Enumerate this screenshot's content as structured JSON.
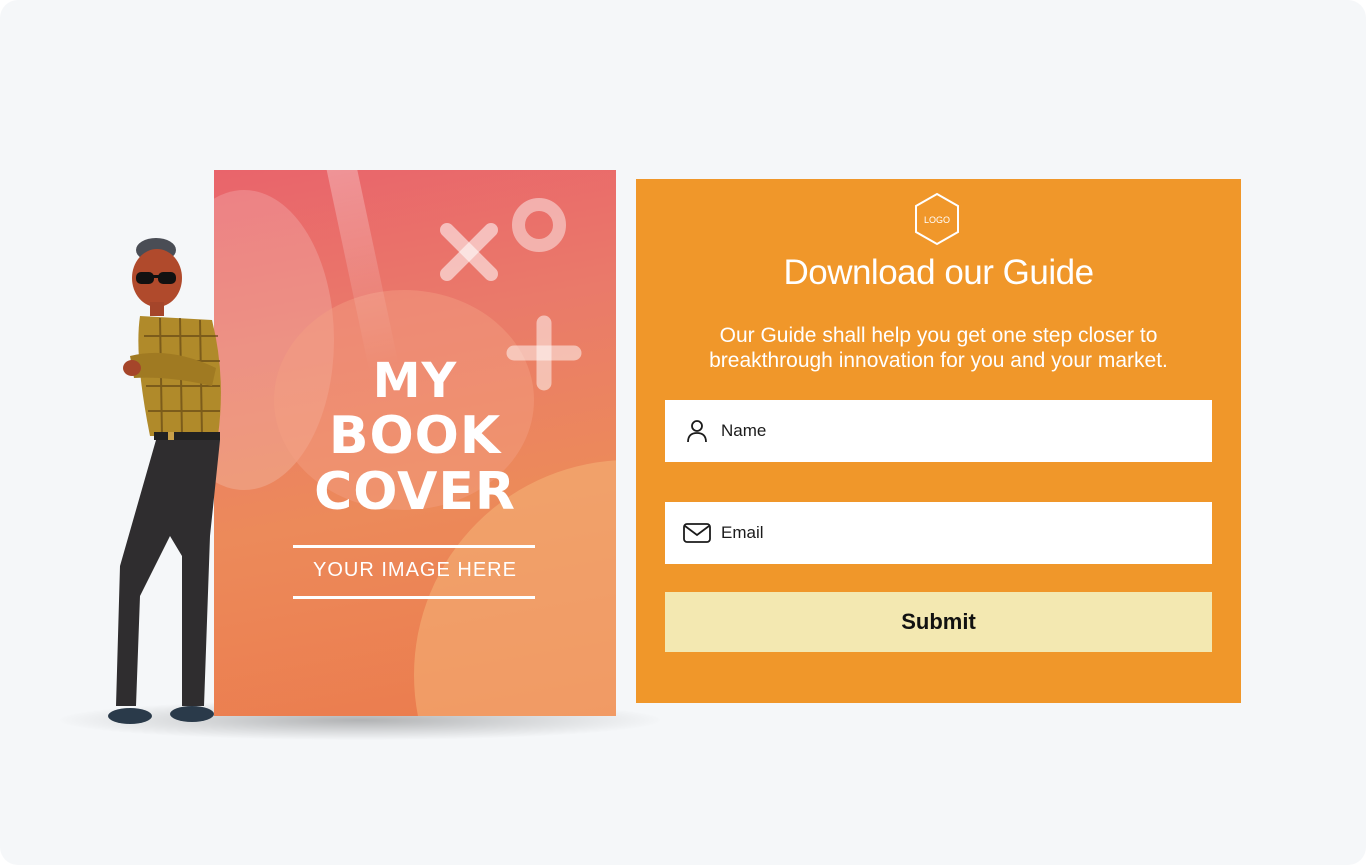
{
  "book": {
    "title_line1": "MY",
    "title_line2": "BOOK",
    "title_line3": "COVER",
    "subtitle": "YOUR  IMAGE HERE"
  },
  "form": {
    "logo_text": "LOGO",
    "title": "Download our Guide",
    "description": "Our Guide shall help you get one step closer to breakthrough innovation for you and your market.",
    "name_placeholder": "Name",
    "email_placeholder": "Email",
    "submit_label": "Submit"
  },
  "icons": {
    "name_field": "user-icon",
    "email_field": "envelope-icon",
    "cover_decorations": [
      "x-shape-icon",
      "circle-shape-icon",
      "plus-shape-icon"
    ]
  },
  "colors": {
    "background": "#f5f7f9",
    "panel": "#f0972a",
    "button": "#f3e8b1",
    "cover_top": "#e9646b",
    "cover_bottom": "#eb7b4d"
  }
}
